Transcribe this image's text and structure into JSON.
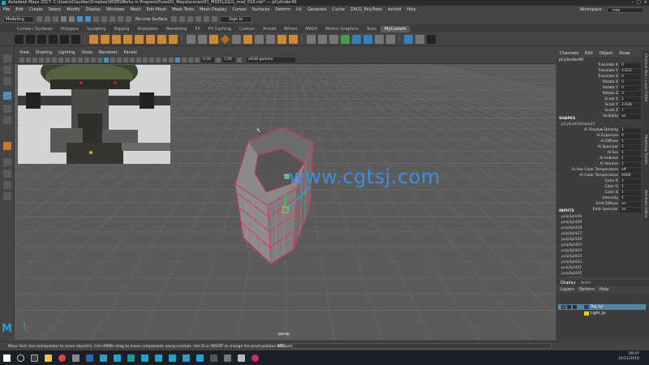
{
  "window": {
    "title": "Autodesk Maya 2017: C:\\Users\\Claudiac\\Dropbox\\WIZK\\Works in Progress\\Fuse\\01_Maya\\scenes\\01_MOD\\LG\\LG_mod_016.mb* --- pCylinder40",
    "controls": [
      "–",
      "□",
      "✕"
    ]
  },
  "menubar": {
    "items": [
      "File",
      "Edit",
      "Create",
      "Select",
      "Modify",
      "Display",
      "Windows",
      "Mesh",
      "Edit Mesh",
      "Mesh Tools",
      "Mesh Display",
      "Curves",
      "Surfaces",
      "Deform",
      "UV",
      "Generate",
      "Cache",
      "ZACG_PolyTools",
      "Arnold",
      "Help"
    ],
    "workspace_label": "Workspace :",
    "workspace_value": "mix"
  },
  "statusline": {
    "mode": "Modeling",
    "live_surface": "No Live Surface",
    "sign_in": "Sign In"
  },
  "shelf": {
    "tabs": [
      "Curves / Surfaces",
      "Polygons",
      "Sculpting",
      "Rigging",
      "Animation",
      "Rendering",
      "FX",
      "FX Caching",
      "Custom",
      "Arnold",
      "Bifrost",
      "MASH",
      "Motion Graphics",
      "Tools",
      "MyCustom"
    ],
    "active_tab": "MyCustom"
  },
  "viewport": {
    "menus": [
      "View",
      "Shading",
      "Lighting",
      "Show",
      "Renderer",
      "Panels"
    ],
    "near_value": "0.00",
    "far_value": "1.00",
    "color_management": "sRGB gamma",
    "camera_label": "persp"
  },
  "watermark": "www.cgtsj.com",
  "channel_box": {
    "menus": [
      "Channels",
      "Edit",
      "Object",
      "Show"
    ],
    "object_name": "pCylinder40",
    "transform": [
      {
        "label": "Translate X",
        "value": "0"
      },
      {
        "label": "Translate Y",
        "value": "4.622"
      },
      {
        "label": "Translate Z",
        "value": "0"
      },
      {
        "label": "Rotate X",
        "value": "0"
      },
      {
        "label": "Rotate Y",
        "value": "0"
      },
      {
        "label": "Rotate Z",
        "value": "0"
      },
      {
        "label": "Scale X",
        "value": "1"
      },
      {
        "label": "Scale Y",
        "value": "2.628"
      },
      {
        "label": "Scale Z",
        "value": "1"
      },
      {
        "label": "Visibility",
        "value": "on"
      }
    ],
    "shapes_header": "SHAPES",
    "shape_name": "pCylinderShape25",
    "shape_attrs": [
      {
        "label": "Ai Shadow Density",
        "value": "1"
      },
      {
        "label": "Ai Exposure",
        "value": "0"
      },
      {
        "label": "Ai Diffuse",
        "value": "1"
      },
      {
        "label": "Ai Specular",
        "value": "1"
      },
      {
        "label": "Ai Sss",
        "value": "1"
      },
      {
        "label": "Ai Indirect",
        "value": "1"
      },
      {
        "label": "Ai Volume",
        "value": "1"
      },
      {
        "label": "Ai Use Color Temperature",
        "value": "off"
      },
      {
        "label": "Ai Color Temperature",
        "value": "6500"
      },
      {
        "label": "Color R",
        "value": "1"
      },
      {
        "label": "Color G",
        "value": "1"
      },
      {
        "label": "Color B",
        "value": "1"
      },
      {
        "label": "Intensity",
        "value": "1"
      },
      {
        "label": "Emit Diffuse",
        "value": "on"
      },
      {
        "label": "Emit Specular",
        "value": "on"
      }
    ],
    "inputs_header": "INPUTS",
    "inputs": [
      "polySplit30",
      "polySplit29",
      "polySplit28",
      "polySplit27",
      "polySplit26",
      "polySplit25",
      "polySplit24",
      "polySplit23",
      "polySplit22",
      "polySplit21",
      "polySplit20",
      "polySplit19"
    ],
    "side_tabs": [
      "Channel Box / Layer Editor",
      "Modeling Toolkit",
      "Attribute Editor"
    ]
  },
  "layer_editor": {
    "tabs": [
      "Display",
      "Anim"
    ],
    "menus": [
      "Layers",
      "Options",
      "Help"
    ],
    "layers": [
      {
        "name": "Top_lyr",
        "color": "#2a3a8a",
        "selected": true,
        "v": "V",
        "p": "P"
      },
      {
        "name": "Light_lyr",
        "color": "#e6d600",
        "selected": false,
        "v": "",
        "p": ""
      }
    ]
  },
  "helpline": {
    "text": "Move Tool: Use manipulator to move object(s). Ctrl+MMB+drag to move components along normals. Use D or INSERT to change the pivot position and axis orientation.",
    "mel_label": "MEL"
  },
  "taskbar": {
    "time": "09:47",
    "date": "24/11/2016",
    "apps": [
      "windows",
      "search",
      "taskview",
      "explorer",
      "chrome",
      "settings",
      "photoshop",
      "maya",
      "maya",
      "3dsmax",
      "maya",
      "maya",
      "maya",
      "maya",
      "maya",
      "app1",
      "app2",
      "app3",
      "app4"
    ]
  },
  "colors": {
    "mesh_wire": "#d8345c",
    "mesh_face": "#7a7a7a",
    "grid_line": "#6a6a6a",
    "accent_blue": "#4a8fc1",
    "highlight_orange": "#c97a2f"
  }
}
